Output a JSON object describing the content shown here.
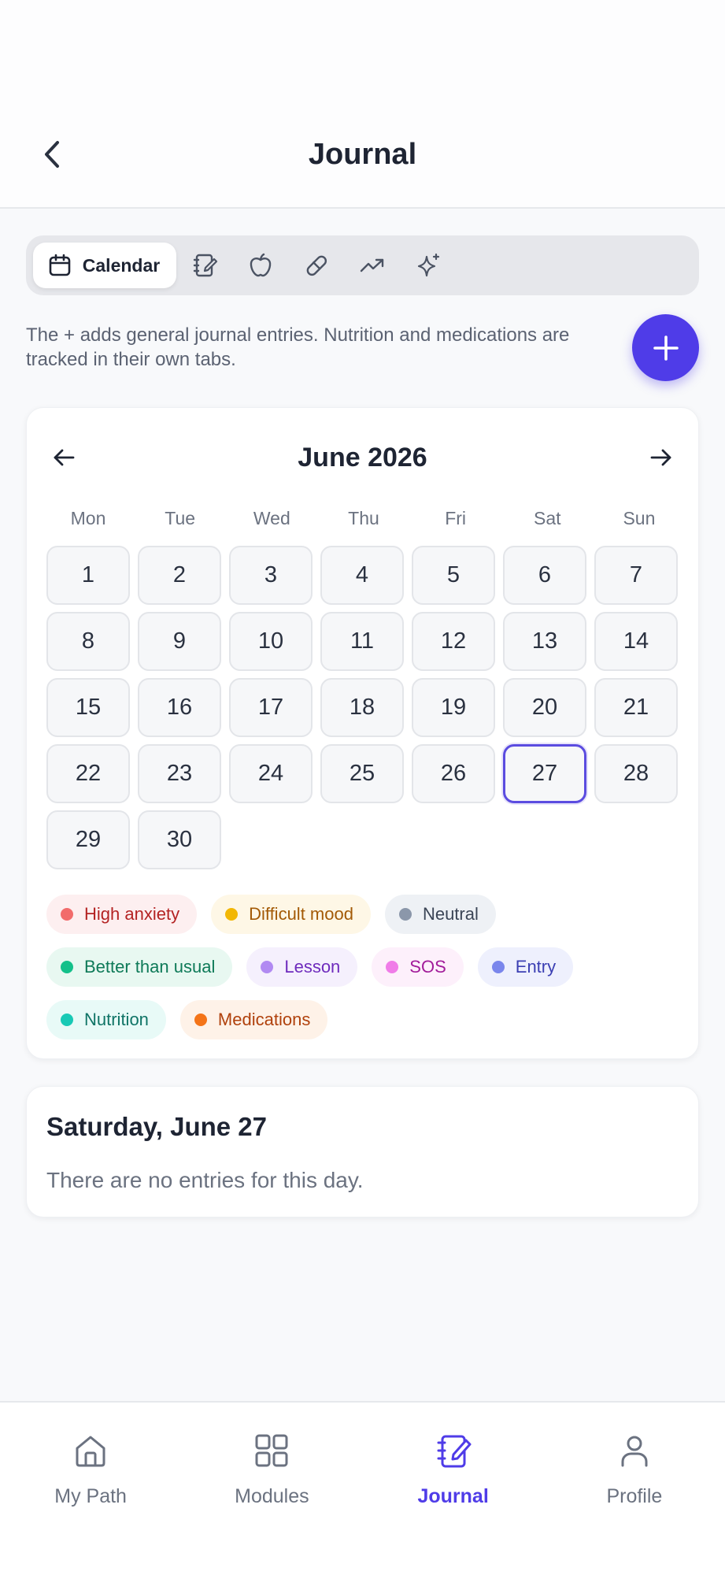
{
  "header": {
    "title": "Journal",
    "back_icon": "chevron-left-icon"
  },
  "tabs": [
    {
      "label": "Calendar",
      "icon": "calendar-icon",
      "active": true
    },
    {
      "label": "",
      "icon": "notebook-icon",
      "active": false
    },
    {
      "label": "",
      "icon": "apple-icon",
      "active": false
    },
    {
      "label": "",
      "icon": "pill-icon",
      "active": false
    },
    {
      "label": "",
      "icon": "trend-icon",
      "active": false
    },
    {
      "label": "",
      "icon": "sparkles-icon",
      "active": false
    }
  ],
  "info": {
    "text": "The + adds general journal entries. Nutrition and medications are tracked in their own tabs."
  },
  "fab": {
    "icon": "plus-icon"
  },
  "calendar": {
    "month_title": "June 2026",
    "weekdays": [
      "Mon",
      "Tue",
      "Wed",
      "Thu",
      "Fri",
      "Sat",
      "Sun"
    ],
    "days": [
      "1",
      "2",
      "3",
      "4",
      "5",
      "6",
      "7",
      "8",
      "9",
      "10",
      "11",
      "12",
      "13",
      "14",
      "15",
      "16",
      "17",
      "18",
      "19",
      "20",
      "21",
      "22",
      "23",
      "24",
      "25",
      "26",
      "27",
      "28",
      "29",
      "30"
    ],
    "selected_day": "27"
  },
  "legend": [
    [
      {
        "label": "High anxiety",
        "dot": "#f26b6b",
        "bg": "#fdeff0",
        "text": "#b42323"
      },
      {
        "label": "Difficult mood",
        "dot": "#f2b705",
        "bg": "#fef7e6",
        "text": "#a35a06"
      },
      {
        "label": "Neutral",
        "dot": "#8b97aa",
        "bg": "#eef1f5",
        "text": "#3b4556"
      }
    ],
    [
      {
        "label": "Better than usual",
        "dot": "#14c08a",
        "bg": "#e8f8f1",
        "text": "#0e7a58"
      },
      {
        "label": "Lesson",
        "dot": "#b18af2",
        "bg": "#f5f0fd",
        "text": "#6e2bbd"
      },
      {
        "label": "SOS",
        "dot": "#f07ce8",
        "bg": "#fdf0fb",
        "text": "#a21c9a"
      },
      {
        "label": "Entry",
        "dot": "#7a86ec",
        "bg": "#eef0fd",
        "text": "#3b3fb3"
      }
    ],
    [
      {
        "label": "Nutrition",
        "dot": "#18c9b5",
        "bg": "#e8faf7",
        "text": "#0f7466"
      },
      {
        "label": "Medications",
        "dot": "#f47418",
        "bg": "#fef2e8",
        "text": "#b0410c"
      }
    ]
  ],
  "selected_day_panel": {
    "title": "Saturday, June 27",
    "empty_text": "There are no entries for this day."
  },
  "bottom_nav": [
    {
      "label": "My Path",
      "icon": "home-icon",
      "active": false
    },
    {
      "label": "Modules",
      "icon": "grid-icon",
      "active": false
    },
    {
      "label": "Journal",
      "icon": "journal-icon",
      "active": true
    },
    {
      "label": "Profile",
      "icon": "user-icon",
      "active": false
    }
  ],
  "colors": {
    "accent": "#4f3ce8",
    "background": "#f8f9fb"
  }
}
